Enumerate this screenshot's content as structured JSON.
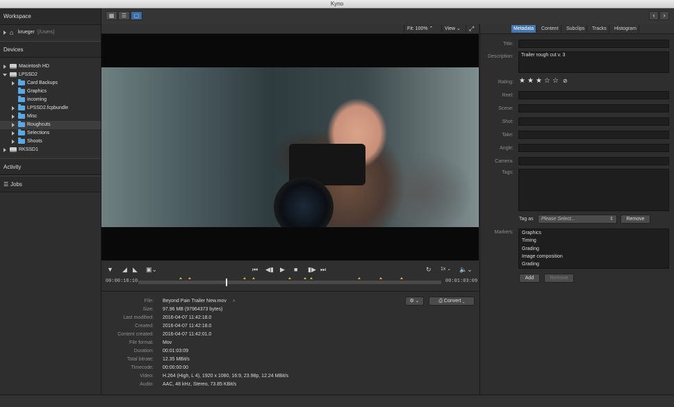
{
  "window": {
    "title": "Kyno"
  },
  "sidebar": {
    "workspace_label": "Workspace",
    "home_item": {
      "name": "krueger",
      "path": "[/Users]"
    },
    "devices_label": "Devices",
    "devices": [
      {
        "label": "Macintosh HD"
      },
      {
        "label": "LPSSD2"
      }
    ],
    "folders": [
      {
        "label": "Card Backups"
      },
      {
        "label": "Graphics"
      },
      {
        "label": "incoming"
      },
      {
        "label": "LPSSD2.fcpbundle"
      },
      {
        "label": "Misc"
      },
      {
        "label": "Roughcuts"
      },
      {
        "label": "Selections"
      },
      {
        "label": "Shoots"
      }
    ],
    "other_drive": "RKSSD1",
    "activity_label": "Activity",
    "jobs_label": "Jobs"
  },
  "viewer": {
    "fit_label": "Fit: 100% ⌃",
    "view_label": "View ⌄",
    "speed_label": "1x",
    "timecode_start": "00:00:18:10",
    "timecode_end": "00:01:03:09",
    "playhead": 0.29,
    "marker_positions": [
      0.14,
      0.17,
      0.35,
      0.38,
      0.5,
      0.55,
      0.57,
      0.73,
      0.8,
      0.87
    ]
  },
  "info": {
    "settings_icon": "gear-icon",
    "convert_label": "Convert",
    "rows": [
      {
        "label": "File:",
        "value": "Beyond Pain Trailer New.mov"
      },
      {
        "label": "Size:",
        "value": "97.96 MB (97964373 bytes)"
      },
      {
        "label": "Last modified:",
        "value": "2016-04-07 11:42:18.0"
      },
      {
        "label": "Created:",
        "value": "2016-04-07 11:42:18.0"
      },
      {
        "label": "Content created:",
        "value": "2016-04-07 11:42:01.0"
      },
      {
        "label": "File format:",
        "value": "Mov"
      },
      {
        "label": "Duration:",
        "value": "00:01:03:09"
      },
      {
        "label": "Total bitrate:",
        "value": "12.35 MBit/s"
      },
      {
        "label": "Timecode:",
        "value": "00:00:00:00"
      },
      {
        "label": "Video:",
        "value": "H.264 (High, L 4), 1920 x 1080, 16:9, 23.98p, 12.24 MBit/s"
      },
      {
        "label": "Audio:",
        "value": "AAC, 48 kHz, Stereo, 73.85 KBit/s"
      }
    ]
  },
  "metadata": {
    "tabs": [
      "Metadata",
      "Content",
      "Subclips",
      "Tracks",
      "Histogram"
    ],
    "active_tab": "Metadata",
    "title_label": "Title:",
    "title_value": "",
    "description_label": "Description:",
    "description_value": "Trailer rough cut v. 3",
    "rating_label": "Rating:",
    "rating": 3,
    "rating_max": 5,
    "fields": [
      {
        "label": "Reel:",
        "value": ""
      },
      {
        "label": "Scene:",
        "value": ""
      },
      {
        "label": "Shot:",
        "value": ""
      },
      {
        "label": "Take:",
        "value": ""
      },
      {
        "label": "Angle:",
        "value": ""
      },
      {
        "label": "Camera:",
        "value": ""
      }
    ],
    "tags_label": "Tags:",
    "tag_as_label": "Tag as",
    "tag_select_placeholder": "Please Select...",
    "remove_label": "Remove",
    "markers_label": "Markers:",
    "markers": [
      "Graphics",
      "Timing",
      "Grading",
      "Image composition",
      "Grading"
    ],
    "add_label": "Add",
    "marker_remove_label": "Remove"
  }
}
